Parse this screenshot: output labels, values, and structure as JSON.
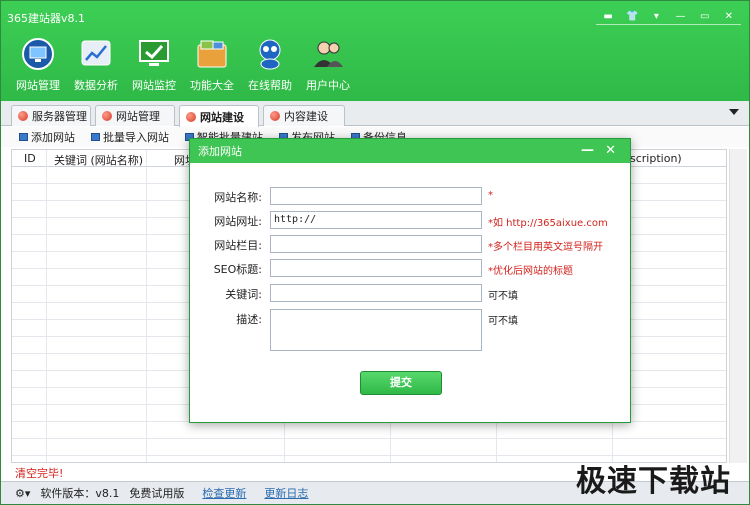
{
  "app": {
    "title": "365建站器v8.1"
  },
  "window_controls": [
    "▬",
    "👕",
    "▾",
    "—",
    "▭",
    "✕"
  ],
  "toolbar": [
    {
      "label": "网站管理",
      "icon": "monitor-icon",
      "color": "#1a5aa8"
    },
    {
      "label": "数据分析",
      "icon": "chart-icon",
      "color": "#e8eef6"
    },
    {
      "label": "网站监控",
      "icon": "monitor-check-icon",
      "color": "#2a9a32"
    },
    {
      "label": "功能大全",
      "icon": "toolbox-icon",
      "color": "#e9a13b"
    },
    {
      "label": "在线帮助",
      "icon": "mascot-icon",
      "color": "#1e66c2"
    },
    {
      "label": "用户中心",
      "icon": "users-icon",
      "color": "#f0f3f6"
    }
  ],
  "tabs": [
    {
      "label": "服务器管理"
    },
    {
      "label": "网站管理"
    },
    {
      "label": "网站建设",
      "active": true
    },
    {
      "label": "内容建设"
    }
  ],
  "subtoolbar": [
    "添加网站",
    "批量导入网站",
    "智能批量建站",
    "发布网站",
    "备份信息"
  ],
  "grid": {
    "columns": [
      "ID",
      "关键词 (网站名称)",
      "网址",
      "scription)"
    ]
  },
  "dialog": {
    "title": "添加网站",
    "fields": [
      {
        "label": "网站名称:",
        "value": "",
        "hint": "*",
        "hint_red": true
      },
      {
        "label": "网站网址:",
        "value": "http://",
        "hint": "*如 http://365aixue.com",
        "hint_red": true
      },
      {
        "label": "网站栏目:",
        "value": "",
        "hint": "*多个栏目用英文逗号隔开",
        "hint_red": true
      },
      {
        "label": "SEO标题:",
        "value": "",
        "hint": "*优化后网站的标题",
        "hint_red": true
      },
      {
        "label": "关键词:",
        "value": "",
        "hint": "可不填",
        "hint_red": false
      },
      {
        "label": "描述:",
        "value": "",
        "hint": "可不填",
        "hint_red": false
      }
    ],
    "submit_label": "提交"
  },
  "status": {
    "message": "清空完毕!",
    "version": "软件版本：v8.1",
    "edition": "免费试用版",
    "check_update": "检查更新",
    "changelog": "更新日志"
  },
  "watermark": "极速下载站"
}
